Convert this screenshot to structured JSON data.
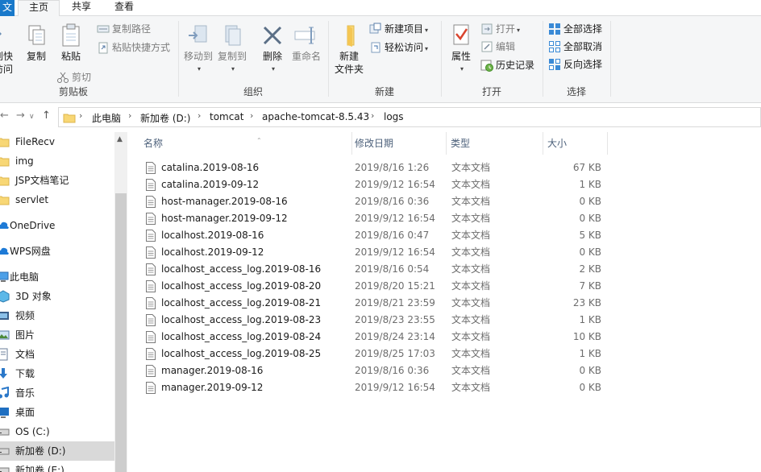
{
  "tabs": {
    "file": "文",
    "home": "主页",
    "share": "共享",
    "view": "查看"
  },
  "ribbon": {
    "clipboard": {
      "pin_label_1": "到快",
      "pin_label_2": "访问",
      "copy": "复制",
      "paste": "粘贴",
      "copy_path": "复制路径",
      "paste_shortcut": "粘贴快捷方式",
      "cut": "剪切",
      "group": "剪贴板"
    },
    "organize": {
      "move_to": "移动到",
      "copy_to": "复制到",
      "delete": "删除",
      "rename": "重命名",
      "group": "组织"
    },
    "new": {
      "new_folder_1": "新建",
      "new_folder_2": "文件夹",
      "new_item": "新建项目",
      "easy_access": "轻松访问",
      "group": "新建"
    },
    "open": {
      "properties": "属性",
      "open": "打开",
      "edit": "编辑",
      "history": "历史记录",
      "group": "打开"
    },
    "select": {
      "select_all": "全部选择",
      "select_none": "全部取消",
      "invert": "反向选择",
      "group": "选择"
    }
  },
  "breadcrumb": [
    "此电脑",
    "新加卷 (D:)",
    "tomcat",
    "apache-tomcat-8.5.43",
    "logs"
  ],
  "nav": [
    {
      "label": "FileRecv",
      "icon": "folder-icon"
    },
    {
      "label": "img",
      "icon": "folder-icon"
    },
    {
      "label": "JSP文档笔记",
      "icon": "folder-icon"
    },
    {
      "label": "servlet",
      "icon": "folder-icon"
    },
    {
      "label": "OneDrive",
      "icon": "cloud-icon"
    },
    {
      "label": "WPS网盘",
      "icon": "cloud-icon"
    },
    {
      "label": "此电脑",
      "icon": "computer-icon"
    },
    {
      "label": "3D 对象",
      "icon": "3d-objects-icon"
    },
    {
      "label": "视频",
      "icon": "video-icon"
    },
    {
      "label": "图片",
      "icon": "pictures-icon"
    },
    {
      "label": "文档",
      "icon": "documents-icon"
    },
    {
      "label": "下载",
      "icon": "download-icon"
    },
    {
      "label": "音乐",
      "icon": "music-icon"
    },
    {
      "label": "桌面",
      "icon": "desktop-icon"
    },
    {
      "label": "OS (C:)",
      "icon": "drive-icon"
    },
    {
      "label": "新加卷 (D:)",
      "icon": "drive-icon",
      "selected": true
    },
    {
      "label": "新加卷 (E:)",
      "icon": "drive-icon"
    }
  ],
  "columns": {
    "name": "名称",
    "date": "修改日期",
    "type": "类型",
    "size": "大小"
  },
  "files": [
    {
      "name": "catalina.2019-08-16",
      "date": "2019/8/16 1:26",
      "type": "文本文档",
      "size": "67 KB"
    },
    {
      "name": "catalina.2019-09-12",
      "date": "2019/9/12 16:54",
      "type": "文本文档",
      "size": "1 KB"
    },
    {
      "name": "host-manager.2019-08-16",
      "date": "2019/8/16 0:36",
      "type": "文本文档",
      "size": "0 KB"
    },
    {
      "name": "host-manager.2019-09-12",
      "date": "2019/9/12 16:54",
      "type": "文本文档",
      "size": "0 KB"
    },
    {
      "name": "localhost.2019-08-16",
      "date": "2019/8/16 0:47",
      "type": "文本文档",
      "size": "5 KB"
    },
    {
      "name": "localhost.2019-09-12",
      "date": "2019/9/12 16:54",
      "type": "文本文档",
      "size": "0 KB"
    },
    {
      "name": "localhost_access_log.2019-08-16",
      "date": "2019/8/16 0:54",
      "type": "文本文档",
      "size": "2 KB"
    },
    {
      "name": "localhost_access_log.2019-08-20",
      "date": "2019/8/20 15:21",
      "type": "文本文档",
      "size": "7 KB"
    },
    {
      "name": "localhost_access_log.2019-08-21",
      "date": "2019/8/21 23:59",
      "type": "文本文档",
      "size": "23 KB"
    },
    {
      "name": "localhost_access_log.2019-08-23",
      "date": "2019/8/23 23:55",
      "type": "文本文档",
      "size": "1 KB"
    },
    {
      "name": "localhost_access_log.2019-08-24",
      "date": "2019/8/24 23:14",
      "type": "文本文档",
      "size": "10 KB"
    },
    {
      "name": "localhost_access_log.2019-08-25",
      "date": "2019/8/25 17:03",
      "type": "文本文档",
      "size": "1 KB"
    },
    {
      "name": "manager.2019-08-16",
      "date": "2019/8/16 0:36",
      "type": "文本文档",
      "size": "0 KB"
    },
    {
      "name": "manager.2019-09-12",
      "date": "2019/9/12 16:54",
      "type": "文本文档",
      "size": "0 KB"
    }
  ],
  "colors": {
    "accent": "#1979ca",
    "folder": "#f8d775",
    "selected_row": "#d9d9d9"
  }
}
